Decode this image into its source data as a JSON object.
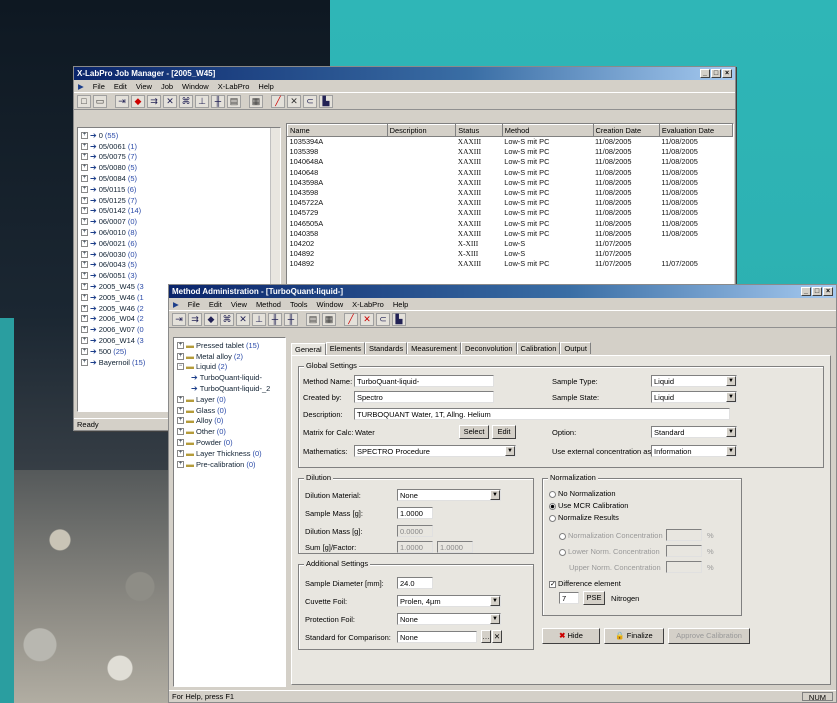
{
  "job_manager": {
    "title": "X-LabPro Job Manager - [2005_W45]",
    "menu": [
      "File",
      "Edit",
      "View",
      "Job",
      "Window",
      "X-LabPro",
      "Help"
    ],
    "status": "Ready",
    "tree": [
      {
        "label": "0",
        "count": "(55)"
      },
      {
        "label": "05/0061",
        "count": "(1)"
      },
      {
        "label": "05/0075",
        "count": "(7)"
      },
      {
        "label": "05/0080",
        "count": "(5)"
      },
      {
        "label": "05/0084",
        "count": "(5)"
      },
      {
        "label": "05/0115",
        "count": "(6)"
      },
      {
        "label": "05/0125",
        "count": "(7)"
      },
      {
        "label": "05/0142",
        "count": "(14)"
      },
      {
        "label": "06/0007",
        "count": "(0)"
      },
      {
        "label": "06/0010",
        "count": "(8)"
      },
      {
        "label": "06/0021",
        "count": "(6)"
      },
      {
        "label": "06/0030",
        "count": "(0)"
      },
      {
        "label": "06/0043",
        "count": "(5)"
      },
      {
        "label": "06/0051",
        "count": "(3)"
      },
      {
        "label": "2005_W45",
        "count": "(3"
      },
      {
        "label": "2005_W46",
        "count": "(1"
      },
      {
        "label": "2005_W46",
        "count": "(2"
      },
      {
        "label": "2006_W04",
        "count": "(2"
      },
      {
        "label": "2006_W07",
        "count": "(0"
      },
      {
        "label": "2006_W14",
        "count": "(3"
      },
      {
        "label": "500",
        "count": "(25)"
      },
      {
        "label": "Bayernoil",
        "count": "(15)"
      }
    ],
    "columns": [
      "Name",
      "Description",
      "Status",
      "Method",
      "Creation Date",
      "Evaluation Date"
    ],
    "rows": [
      [
        "1035394A",
        "",
        "XAXIII",
        "Low-S mit PC",
        "11/08/2005",
        "11/08/2005"
      ],
      [
        "1035398",
        "",
        "XAXIII",
        "Low-S mit PC",
        "11/08/2005",
        "11/08/2005"
      ],
      [
        "1040648A",
        "",
        "XAXIII",
        "Low-S mit PC",
        "11/08/2005",
        "11/08/2005"
      ],
      [
        "1040648",
        "",
        "XAXIII",
        "Low-S mit PC",
        "11/08/2005",
        "11/08/2005"
      ],
      [
        "1043598A",
        "",
        "XAXIII",
        "Low-S mit PC",
        "11/08/2005",
        "11/08/2005"
      ],
      [
        "1043598",
        "",
        "XAXIII",
        "Low-S mit PC",
        "11/08/2005",
        "11/08/2005"
      ],
      [
        "1045722A",
        "",
        "XAXIII",
        "Low-S mit PC",
        "11/08/2005",
        "11/08/2005"
      ],
      [
        "1045729",
        "",
        "XAXIII",
        "Low-S mit PC",
        "11/08/2005",
        "11/08/2005"
      ],
      [
        "1046505A",
        "",
        "XAXIII",
        "Low-S mit PC",
        "11/08/2005",
        "11/08/2005"
      ],
      [
        "1040358",
        "",
        "XAXIII",
        "Low-S mit PC",
        "11/08/2005",
        "11/08/2005"
      ],
      [
        "104202",
        "",
        "X-XIII",
        "Low-S",
        "11/07/2005",
        ""
      ],
      [
        "104892",
        "",
        "X-XIII",
        "Low-S",
        "11/07/2005",
        ""
      ],
      [
        "104892",
        "",
        "XAXIII",
        "Low-S mit PC",
        "11/07/2005",
        "11/07/2005"
      ]
    ]
  },
  "method_admin": {
    "title": "Method Administration - [TurboQuant-liquid-]",
    "menu": [
      "File",
      "Edit",
      "View",
      "Method",
      "Tools",
      "Window",
      "X-LabPro",
      "Help"
    ],
    "status": "For Help, press F1",
    "status_right": "NUM",
    "tree": [
      {
        "label": "Pressed tablet",
        "count": "(15)"
      },
      {
        "label": "Metal alloy",
        "count": "(2)"
      },
      {
        "label": "Liquid",
        "count": "(2)"
      },
      {
        "label": "TurboQuant-liquid-",
        "count": ""
      },
      {
        "label": "TurboQuant-liquid-_2",
        "count": ""
      },
      {
        "label": "Layer",
        "count": "(0)"
      },
      {
        "label": "Glass",
        "count": "(0)"
      },
      {
        "label": "Alloy",
        "count": "(0)"
      },
      {
        "label": "Other",
        "count": "(0)"
      },
      {
        "label": "Powder",
        "count": "(0)"
      },
      {
        "label": "Layer Thickness",
        "count": "(0)"
      },
      {
        "label": "Pre-calibration",
        "count": "(0)"
      }
    ],
    "tabs": [
      "General",
      "Elements",
      "Standards",
      "Measurement",
      "Deconvolution",
      "Calibration",
      "Output"
    ],
    "global": {
      "group_label": "Global Settings",
      "method_name_label": "Method Name:",
      "method_name": "TurboQuant-liquid-",
      "created_by_label": "Created by:",
      "created_by": "Spectro",
      "description_label": "Description:",
      "description": "TURBOQUANT Water, 1T, Allng. Helium",
      "matrix_label": "Matrix for Calc:",
      "matrix": "Water",
      "select_label": "Select",
      "edit_label": "Edit",
      "mathematics_label": "Mathematics:",
      "mathematics": "SPECTRO Procedure",
      "sample_type_label": "Sample Type:",
      "sample_type": "Liquid",
      "sample_state_label": "Sample State:",
      "sample_state": "Liquid",
      "option_label": "Option:",
      "option": "Standard",
      "ext_conc_label": "Use external concentration as:",
      "ext_conc": "Information"
    },
    "dilution": {
      "group_label": "Dilution",
      "material_label": "Dilution Material:",
      "material": "None",
      "sample_mass_label": "Sample Mass [g]:",
      "sample_mass": "1.0000",
      "dil_mass_label": "Dilution Mass [g]:",
      "dil_mass": "0.0000",
      "factor_label": "Sum [g]/Factor:",
      "sum": "1.0000",
      "factor": "1.0000"
    },
    "additional": {
      "group_label": "Additional Settings",
      "diameter_label": "Sample Diameter [mm]:",
      "diameter": "24.0",
      "cuvette_label": "Cuvette Foil:",
      "cuvette": "Prolen, 4µm",
      "protection_label": "Protection Foil:",
      "protection": "None",
      "standard_label": "Standard for Comparison:",
      "standard": "None"
    },
    "normalization": {
      "group_label": "Normalization",
      "opt1": "No Normalization",
      "opt2": "Use MCR Calibration",
      "opt3": "Normalize Results",
      "sub1": "Normalization Concentration",
      "sub2": "Lower Norm. Concentration",
      "sub3": "Upper Norm. Concentration",
      "pct": "%",
      "difference_label": "Difference element",
      "diff_z": "7",
      "diff_btn": "PSE",
      "diff_elem": "Nitrogen"
    },
    "buttons": {
      "hide": "Hide",
      "finalize": "Finalize",
      "approve": "Approve Calibration"
    }
  }
}
